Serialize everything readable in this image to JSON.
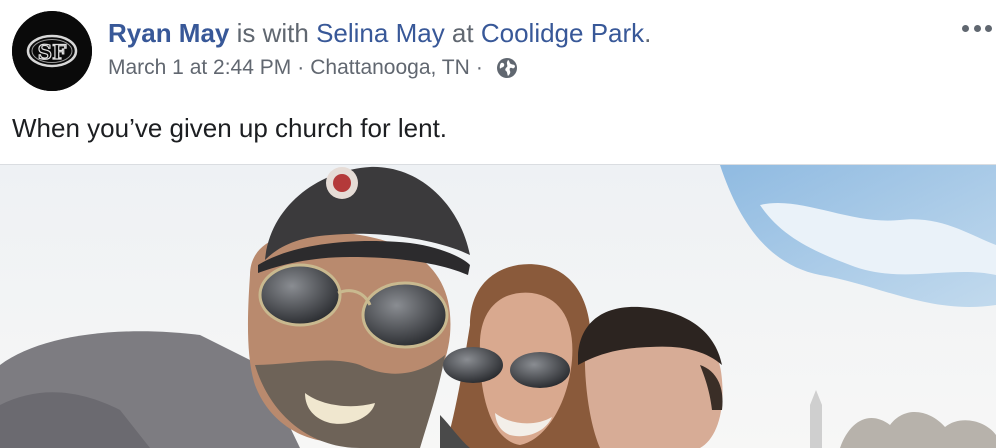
{
  "post": {
    "author": "Ryan May",
    "with_text": " is with ",
    "tagged_person": "Selina May",
    "at_text": " at ",
    "location": "Coolidge Park",
    "period": ".",
    "date": "March 1 at 2:44 PM",
    "separator": "·",
    "city": "Chattanooga, TN",
    "privacy_icon": "globe-icon",
    "more_icon": "more-options-icon",
    "body": "When you’ve given up church for lent.",
    "avatar_monogram": "SF"
  },
  "colors": {
    "link": "#385898",
    "meta": "#616770",
    "text": "#1c1e21",
    "divider": "#dadde1",
    "avatar_bg": "#0a0a0a"
  }
}
